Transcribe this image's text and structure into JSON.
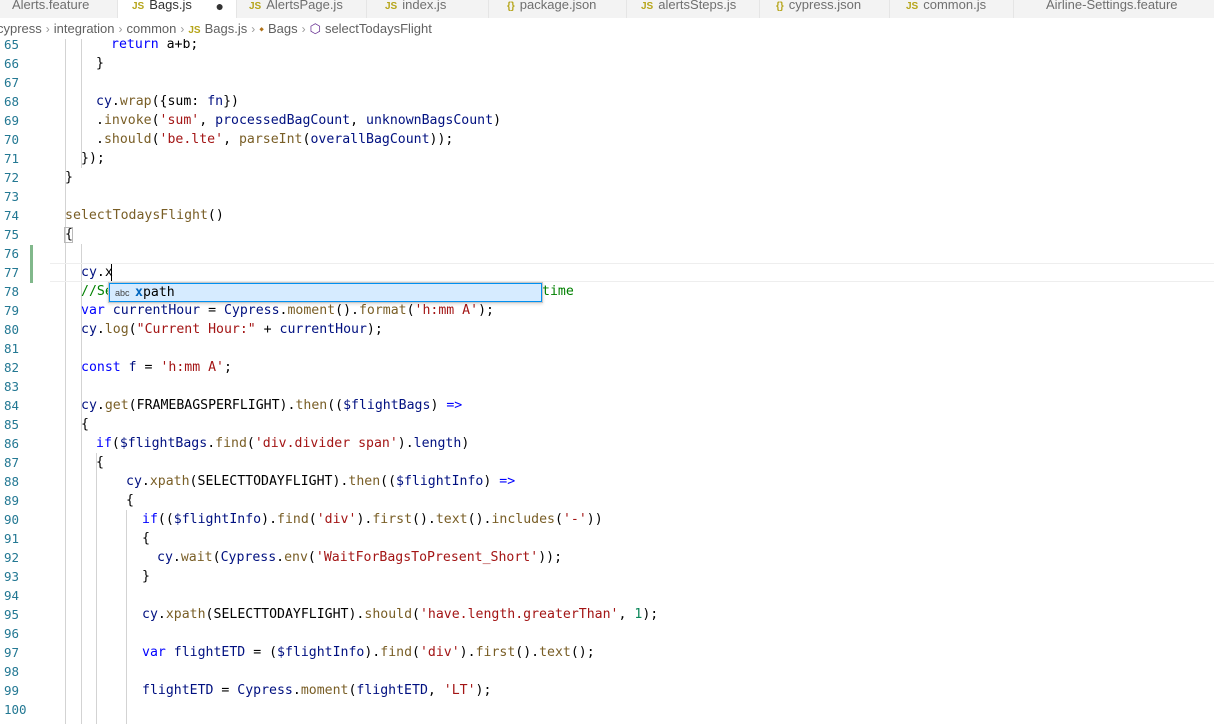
{
  "tabs": [
    {
      "label": "Alerts.feature",
      "icon": "feature-file-icon",
      "icon_text": "",
      "active": false
    },
    {
      "label": "Bags.js",
      "icon": "js-file-icon",
      "icon_text": "JS",
      "active": true,
      "dirty": "●"
    },
    {
      "label": "AlertsPage.js",
      "icon": "js-file-icon",
      "icon_text": "JS",
      "active": false
    },
    {
      "label": "index.js",
      "icon": "js-file-icon",
      "icon_text": "JS",
      "active": false
    },
    {
      "label": "package.json",
      "icon": "json-file-icon",
      "icon_text": "{}",
      "active": false
    },
    {
      "label": "alertsSteps.js",
      "icon": "js-file-icon",
      "icon_text": "JS",
      "active": false
    },
    {
      "label": "cypress.json",
      "icon": "json-file-icon",
      "icon_text": "{}",
      "active": false
    },
    {
      "label": "common.js",
      "icon": "js-file-icon",
      "icon_text": "JS",
      "active": false
    },
    {
      "label": "Airline-Settings.feature",
      "icon": "feature-file-icon",
      "icon_text": "",
      "active": false
    }
  ],
  "breadcrumb": {
    "folders": [
      "cypress",
      "integration",
      "common"
    ],
    "file": "Bags.js",
    "file_icon_text": "JS",
    "class_name": "Bags",
    "method_name": "selectTodaysFlight"
  },
  "line_numbers": [
    "65",
    "66",
    "67",
    "68",
    "69",
    "70",
    "71",
    "72",
    "73",
    "74",
    "75",
    "76",
    "77",
    "78",
    "79",
    "80",
    "81",
    "82",
    "83",
    "84",
    "85",
    "86",
    "87",
    "88",
    "89",
    "90",
    "91",
    "92",
    "93",
    "94",
    "95",
    "96",
    "97",
    "98",
    "99",
    "100"
  ],
  "code": {
    "l65": [
      "return",
      " a+b;"
    ],
    "l66": "}",
    "l68": [
      "cy",
      ".",
      "wrap",
      "({sum: ",
      "fn",
      "})"
    ],
    "l69": [
      ".",
      "invoke",
      "(",
      "'sum'",
      ", ",
      "processedBagCount",
      ", ",
      "unknownBagsCount",
      ")"
    ],
    "l70": [
      ".",
      "should",
      "(",
      "'be.lte'",
      ", ",
      "parseInt",
      "(",
      "overallBagCount",
      "));"
    ],
    "l71": "});",
    "l72": "}",
    "l74": [
      "selectTodaysFlight",
      "()"
    ],
    "l75": "{",
    "l77": [
      "cy",
      ".x"
    ],
    "l78_start": "//Se",
    "l78_end": "time",
    "l79": [
      "var",
      " ",
      "currentHour",
      " = ",
      "Cypress",
      ".",
      "moment",
      "().",
      "format",
      "(",
      "'h:mm A'",
      ");"
    ],
    "l80": [
      "cy",
      ".",
      "log",
      "(",
      "\"Current Hour:\"",
      " + ",
      "currentHour",
      ");"
    ],
    "l82": [
      "const",
      " ",
      "f",
      " = ",
      "'h:mm A'",
      ";"
    ],
    "l84": [
      "cy",
      ".",
      "get",
      "(",
      "FRAMEBAGSPERFLIGHT",
      ").",
      "then",
      "((",
      "$flightBags",
      ") ",
      "=>"
    ],
    "l85": "{",
    "l86": [
      "if",
      "(",
      "$flightBags",
      ".",
      "find",
      "(",
      "'div.divider span'",
      ").",
      "length",
      ")"
    ],
    "l87": "{",
    "l88": [
      "cy",
      ".",
      "xpath",
      "(",
      "SELECTTODAYFLIGHT",
      ").",
      "then",
      "((",
      "$flightInfo",
      ") ",
      "=>"
    ],
    "l89": "{",
    "l90": [
      "if",
      "((",
      "$flightInfo",
      ").",
      "find",
      "(",
      "'div'",
      ").",
      "first",
      "().",
      "text",
      "().",
      "includes",
      "(",
      "'-'",
      "))"
    ],
    "l91": "{",
    "l92": [
      "cy",
      ".",
      "wait",
      "(",
      "Cypress",
      ".",
      "env",
      "(",
      "'WaitForBagsToPresent_Short'",
      "));"
    ],
    "l93": "}",
    "l95": [
      "cy",
      ".",
      "xpath",
      "(",
      "SELECTTODAYFLIGHT",
      ").",
      "should",
      "(",
      "'have.length.greaterThan'",
      ", ",
      "1",
      ");"
    ],
    "l97": [
      "var",
      " ",
      "flightETD",
      " = (",
      "$flightInfo",
      ").",
      "find",
      "(",
      "'div'",
      ").",
      "first",
      "().",
      "text",
      "();"
    ],
    "l99": [
      "flightETD",
      " = ",
      "Cypress",
      ".",
      "moment",
      "(",
      "flightETD",
      ", ",
      "'LT'",
      ");"
    ]
  },
  "suggest": {
    "kind": "abc",
    "match": "x",
    "rest": "path"
  },
  "colors": {
    "keyword": "#0000ff",
    "string": "#a31515",
    "function": "#795e26",
    "variable": "#001080",
    "comment": "#008000",
    "number": "#098658",
    "line_number": "#237893",
    "modified": "#81b88b"
  }
}
